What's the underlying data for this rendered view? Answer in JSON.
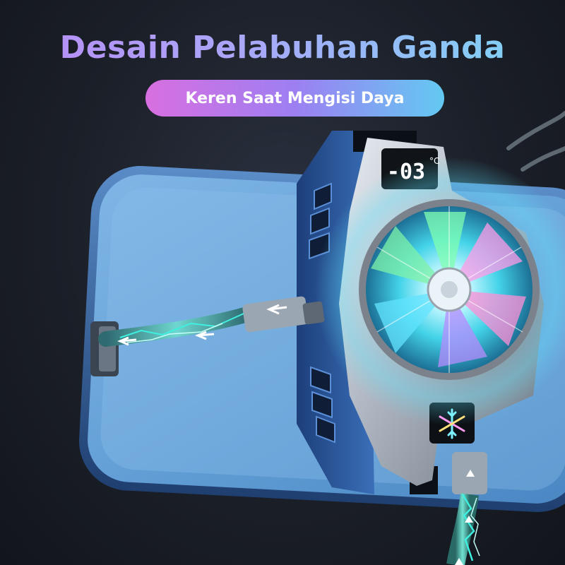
{
  "headline": "Desain Pelabuhan Ganda",
  "subheadline": "Keren Saat Mengisi Daya",
  "display": {
    "temperature": "-03",
    "unit": "°C"
  },
  "colors": {
    "headline_gradient": [
      "#b98cf5",
      "#7ad8f5"
    ],
    "pill_gradient": [
      "#d86fe0",
      "#9d7ff2",
      "#63c9f2"
    ],
    "lightning": "#3ef0e0",
    "phone_frame": "#2f5f9e"
  },
  "icons": [
    "cooling-fan-icon",
    "snowflake-icon",
    "charging-cable-icon",
    "arrow-icon",
    "lightning-icon"
  ]
}
